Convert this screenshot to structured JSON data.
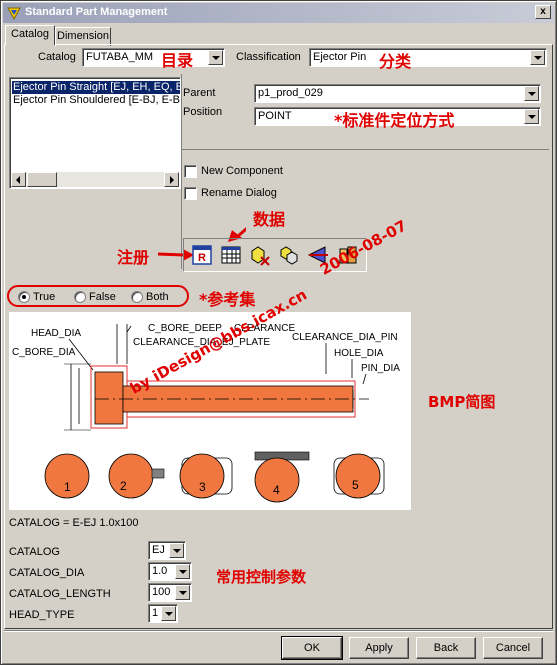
{
  "window": {
    "title": "Standard Part Management",
    "close_glyph": "x"
  },
  "tabs": [
    {
      "label": "Catalog"
    },
    {
      "label": "Dimension"
    }
  ],
  "catalog": {
    "label": "Catalog",
    "value": "FUTABA_MM"
  },
  "classification": {
    "label": "Classification",
    "value": "Ejector Pin"
  },
  "list_items": [
    {
      "label": "Ejector Pin Straight [EJ, EH, EQ, E"
    },
    {
      "label": "Ejector Pin Shouldered [E-BJ, E-BH"
    }
  ],
  "parent": {
    "label": "Parent",
    "value": "p1_prod_029"
  },
  "position": {
    "label": "Position",
    "value": "POINT"
  },
  "options": {
    "new_component": "New Component",
    "rename_dialog": "Rename Dialog"
  },
  "toolbar": {
    "icons": [
      "register-icon",
      "table-icon",
      "delete-component-icon",
      "copy-component-icon",
      "reposition-icon",
      "library-icon"
    ]
  },
  "radios": {
    "true_label": "True",
    "false_label": "False",
    "both_label": "Both",
    "selected": "True"
  },
  "annotations": {
    "catalog_cn": "目录",
    "classification_cn": "分类",
    "position_cn": "*标准件定位方式",
    "data_cn": "数据",
    "register_cn": "注册",
    "reference_cn": "*参考集",
    "bmp_cn": "BMP简图",
    "params_cn": "常用控制参数",
    "watermark": "by iDesign@bbs.icax.cn",
    "watermark_date": "2006-08-07"
  },
  "diagram": {
    "labels": {
      "head_dia": "HEAD_DIA",
      "c_bore_dia": "C_BORE_DIA",
      "c_bore_deep": "C_BORE_DEEP",
      "clearance": "CLEARANCE",
      "clearance_dia_ej_plate": "CLEARANCE_DIA_EJ_PLATE",
      "clearance_dia_pin": "CLEARANCE_DIA_PIN",
      "hole_dia": "HOLE_DIA",
      "pin_dia": "PIN_DIA"
    },
    "sections": [
      "1",
      "2",
      "3",
      "4",
      "5"
    ]
  },
  "catalog_string": "CATALOG = E-EJ 1.0x100",
  "params": [
    {
      "label": "CATALOG",
      "value": "EJ"
    },
    {
      "label": "CATALOG_DIA",
      "value": "1.0"
    },
    {
      "label": "CATALOG_LENGTH",
      "value": "100"
    },
    {
      "label": "HEAD_TYPE",
      "value": "1"
    }
  ],
  "buttons": {
    "ok": "OK",
    "apply": "Apply",
    "back": "Back",
    "cancel": "Cancel"
  },
  "colors": {
    "accent_red": "#e00000",
    "part_orange": "#f07840",
    "title_bar": "#9aa0b8",
    "selection": "#0a246a"
  }
}
